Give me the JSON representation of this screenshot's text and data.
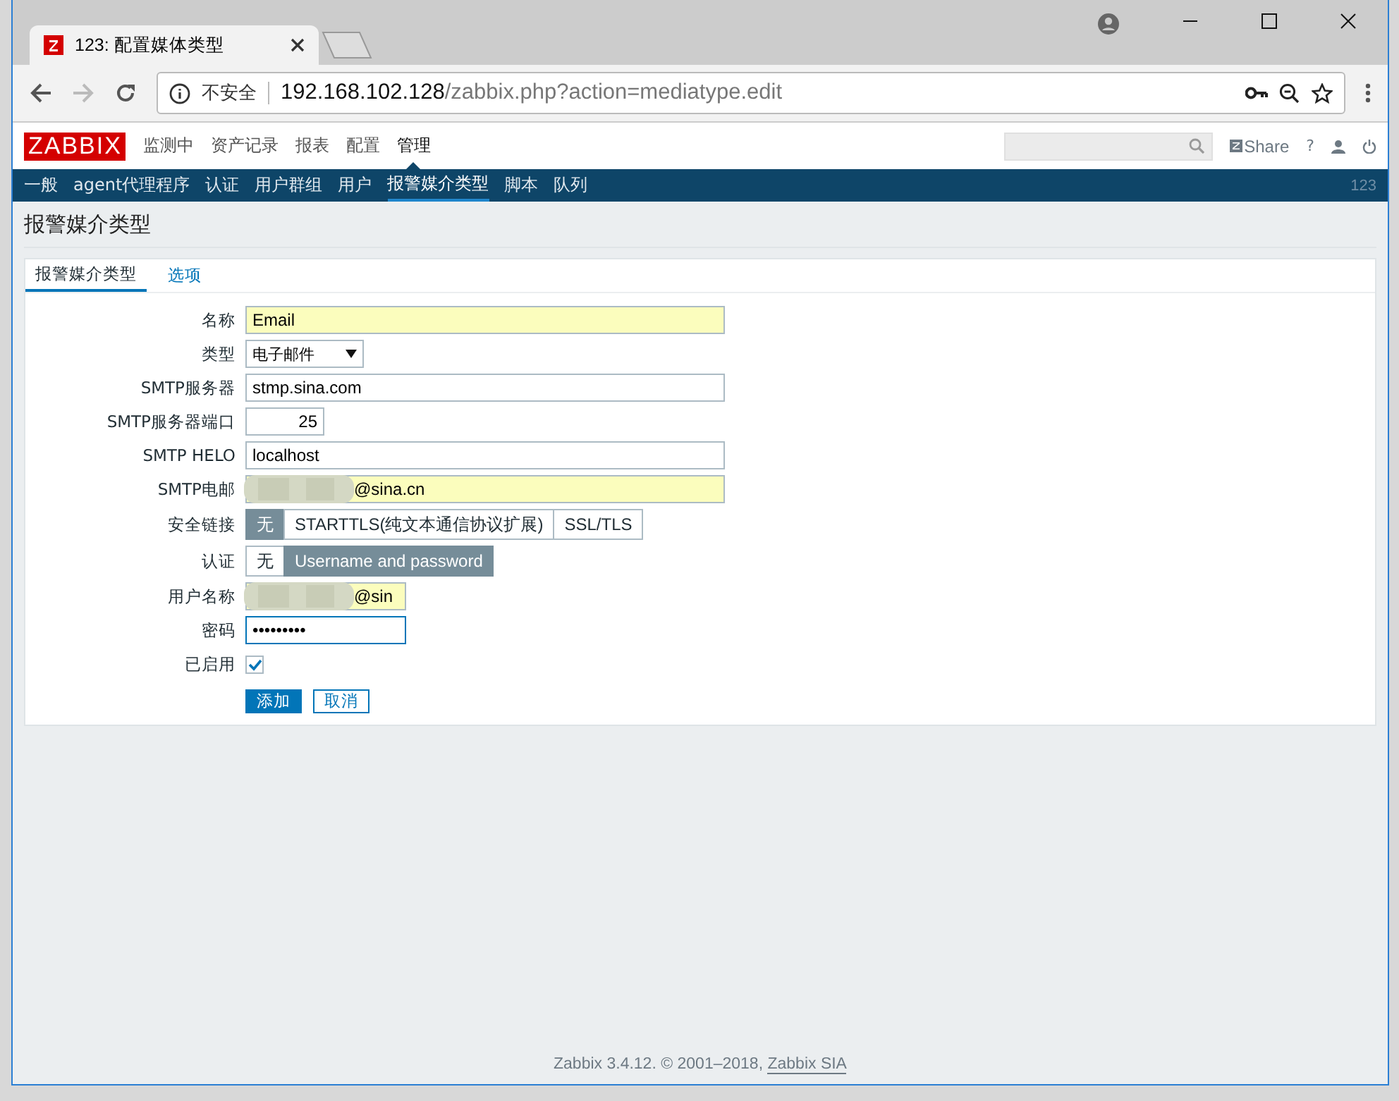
{
  "browser": {
    "tab_title": "123: 配置媒体类型",
    "secure_label": "不安全",
    "address_host": "192.168.102.128",
    "address_path": "/zabbix.php?action=mediatype.edit"
  },
  "top_menu": {
    "logo": "ZABBIX",
    "items": [
      {
        "label": "监测中",
        "selected": false
      },
      {
        "label": "资产记录",
        "selected": false
      },
      {
        "label": "报表",
        "selected": false
      },
      {
        "label": "配置",
        "selected": false
      },
      {
        "label": "管理",
        "selected": true
      }
    ],
    "share": "Share",
    "help": "?"
  },
  "sub_menu": {
    "items": [
      {
        "label": "一般",
        "selected": false
      },
      {
        "label": "agent代理程序",
        "selected": false
      },
      {
        "label": "认证",
        "selected": false
      },
      {
        "label": "用户群组",
        "selected": false
      },
      {
        "label": "用户",
        "selected": false
      },
      {
        "label": "报警媒介类型",
        "selected": true
      },
      {
        "label": "脚本",
        "selected": false
      },
      {
        "label": "队列",
        "selected": false
      }
    ],
    "user": "123"
  },
  "page_title": "报警媒介类型",
  "form_tabs": [
    {
      "label": "报警媒介类型",
      "selected": true
    },
    {
      "label": "选项",
      "selected": false
    }
  ],
  "fields": [
    {
      "label": "名称",
      "kind": "text",
      "value": "Email",
      "autofilled": true,
      "redacted": false
    },
    {
      "label": "类型",
      "kind": "select",
      "value": "电子邮件"
    },
    {
      "label": "SMTP服务器",
      "kind": "text",
      "value": "stmp.sina.com",
      "autofilled": false,
      "redacted": false
    },
    {
      "label": "SMTP服务器端口",
      "kind": "number",
      "value": "25"
    },
    {
      "label": "SMTP HELO",
      "kind": "text",
      "value": "localhost",
      "autofilled": false,
      "redacted": false
    },
    {
      "label": "SMTP电邮",
      "kind": "text",
      "value": "@sina.cn",
      "autofilled": true,
      "redacted": true
    },
    {
      "label": "安全链接",
      "kind": "segmented",
      "options": [
        {
          "label": "无",
          "selected": true
        },
        {
          "label": "STARTTLS(纯文本通信协议扩展)",
          "selected": false
        },
        {
          "label": "SSL/TLS",
          "selected": false
        }
      ]
    },
    {
      "label": "认证",
      "kind": "segmented",
      "options": [
        {
          "label": "无",
          "selected": false
        },
        {
          "label": "Username and password",
          "selected": true
        }
      ]
    },
    {
      "label": "用户名称",
      "kind": "short-text",
      "value": "@sin",
      "autofilled": true,
      "redacted": true
    },
    {
      "label": "密码",
      "kind": "password",
      "value": "•••••••••"
    },
    {
      "label": "已启用",
      "kind": "checkbox",
      "checked": true
    }
  ],
  "buttons": [
    {
      "label": "添加",
      "kind": "primary"
    },
    {
      "label": "取消",
      "kind": "secondary"
    }
  ],
  "footer": {
    "text": "Zabbix 3.4.12. © 2001–2018,",
    "link": "Zabbix SIA"
  }
}
